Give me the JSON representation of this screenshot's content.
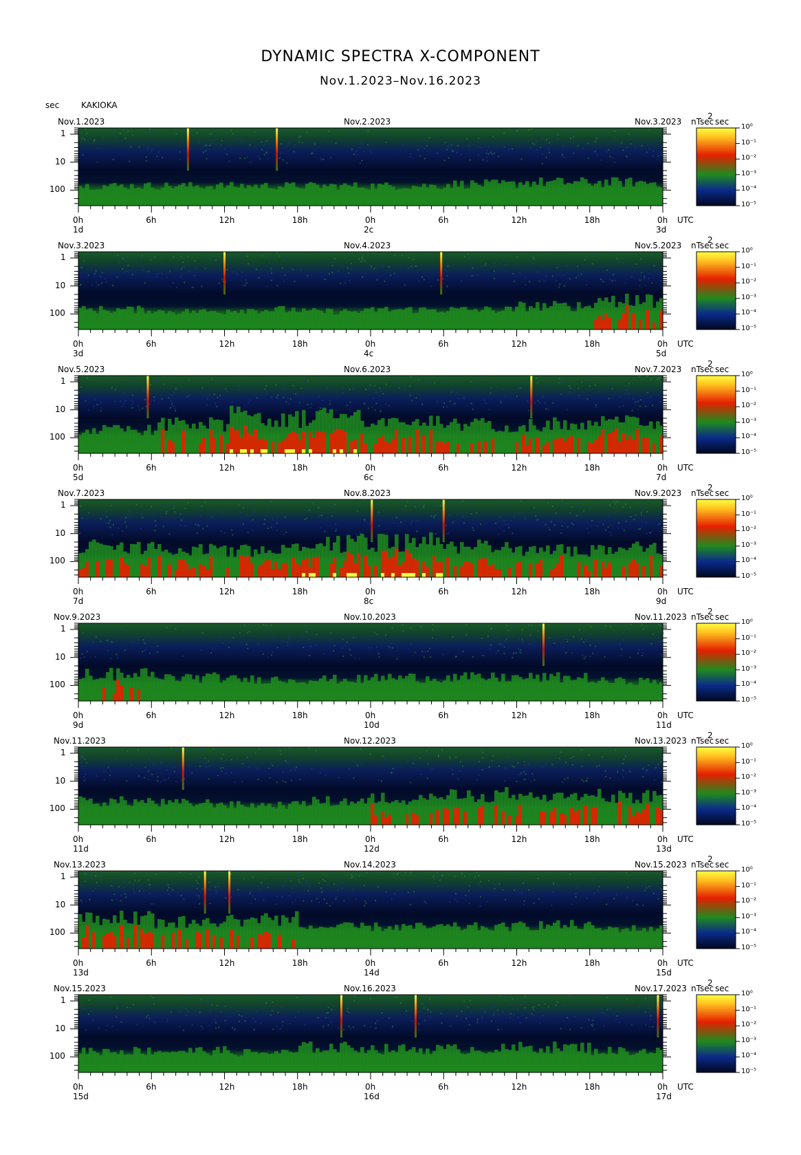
{
  "header": {
    "title": "DYNAMIC SPECTRA X-COMPONENT",
    "subtitle": "Nov.1.2023–Nov.16.2023",
    "unit": "sec",
    "station": "KAKIOKA"
  },
  "colors": {
    "low": "#000820",
    "mid_low": "#0b2a8a",
    "mid": "#1f8a1f",
    "mid_high": "#e52000",
    "high": "#ffff40"
  },
  "chart_data": {
    "type": "heatmap",
    "title": "DYNAMIC SPECTRA X-COMPONENT",
    "subtitle": "Nov.1.2023–Nov.16.2023",
    "ylabel": "sec",
    "y_scale": "log",
    "y_ticks": [
      "1",
      "10",
      "100"
    ],
    "x_ticks": [
      "0h",
      "6h",
      "12h",
      "18h",
      "0h",
      "6h",
      "12h",
      "18h",
      "0h"
    ],
    "x_unit": "UTC",
    "colorbar": {
      "unit": "nT²sec",
      "ticks": [
        "10⁰",
        "10⁻¹",
        "10⁻²",
        "10⁻³",
        "10⁻⁴",
        "10⁻⁵"
      ],
      "range": [
        1e-05,
        1
      ]
    },
    "panels": [
      {
        "left_date": "Nov.1.2023",
        "mid_date": "Nov.2.2023",
        "right_date": "Nov.3.2023",
        "day_labels": [
          "1d",
          "2c",
          "3d"
        ],
        "spikes_h": [
          9.0,
          16.3
        ],
        "activity": [
          0.3,
          0.3,
          0.3,
          0.3,
          0.3,
          0.35,
          0.4,
          0.4
        ]
      },
      {
        "left_date": "Nov.3.2023",
        "mid_date": "Nov.4.2023",
        "right_date": "Nov.5.2023",
        "day_labels": [
          "3d",
          "4c",
          "5d"
        ],
        "spikes_h": [
          12.0,
          29.8
        ],
        "activity": [
          0.3,
          0.25,
          0.3,
          0.25,
          0.3,
          0.3,
          0.4,
          0.55
        ]
      },
      {
        "left_date": "Nov.5.2023",
        "mid_date": "Nov.6.2023",
        "right_date": "Nov.7.2023",
        "day_labels": [
          "5d",
          "6c",
          "7d"
        ],
        "spikes_h": [
          5.7,
          37.2
        ],
        "activity": [
          0.4,
          0.55,
          0.8,
          0.75,
          0.6,
          0.55,
          0.55,
          0.6
        ]
      },
      {
        "left_date": "Nov.7.2023",
        "mid_date": "Nov.8.2023",
        "right_date": "Nov.9.2023",
        "day_labels": [
          "7d",
          "8c",
          "9d"
        ],
        "spikes_h": [
          24.1,
          30.0
        ],
        "activity": [
          0.6,
          0.5,
          0.5,
          0.7,
          0.75,
          0.6,
          0.5,
          0.6
        ]
      },
      {
        "left_date": "Nov.9.2023",
        "mid_date": "Nov.10.2023",
        "right_date": "Nov.11.2023",
        "day_labels": [
          "9d",
          "10d",
          "11d"
        ],
        "spikes_h": [
          38.2
        ],
        "activity": [
          0.5,
          0.4,
          0.35,
          0.35,
          0.4,
          0.4,
          0.4,
          0.3
        ]
      },
      {
        "left_date": "Nov.11.2023",
        "mid_date": "Nov.12.2023",
        "right_date": "Nov.13.2023",
        "day_labels": [
          "11d",
          "12d",
          "13d"
        ],
        "spikes_h": [
          8.6
        ],
        "activity": [
          0.4,
          0.35,
          0.3,
          0.4,
          0.5,
          0.6,
          0.5,
          0.55
        ]
      },
      {
        "left_date": "Nov.13.2023",
        "mid_date": "Nov.14.2023",
        "right_date": "Nov.15.2023",
        "day_labels": [
          "13d",
          "14d",
          "15d"
        ],
        "spikes_h": [
          10.4,
          12.4
        ],
        "activity": [
          0.6,
          0.5,
          0.6,
          0.35,
          0.35,
          0.35,
          0.4,
          0.3
        ]
      },
      {
        "left_date": "Nov.15.2023",
        "mid_date": "Nov.16.2023",
        "right_date": "Nov.17.2023",
        "day_labels": [
          "15d",
          "16d",
          "17d"
        ],
        "spikes_h": [
          21.6,
          27.7,
          47.6
        ],
        "activity": [
          0.35,
          0.35,
          0.3,
          0.45,
          0.4,
          0.4,
          0.45,
          0.35
        ]
      }
    ]
  }
}
